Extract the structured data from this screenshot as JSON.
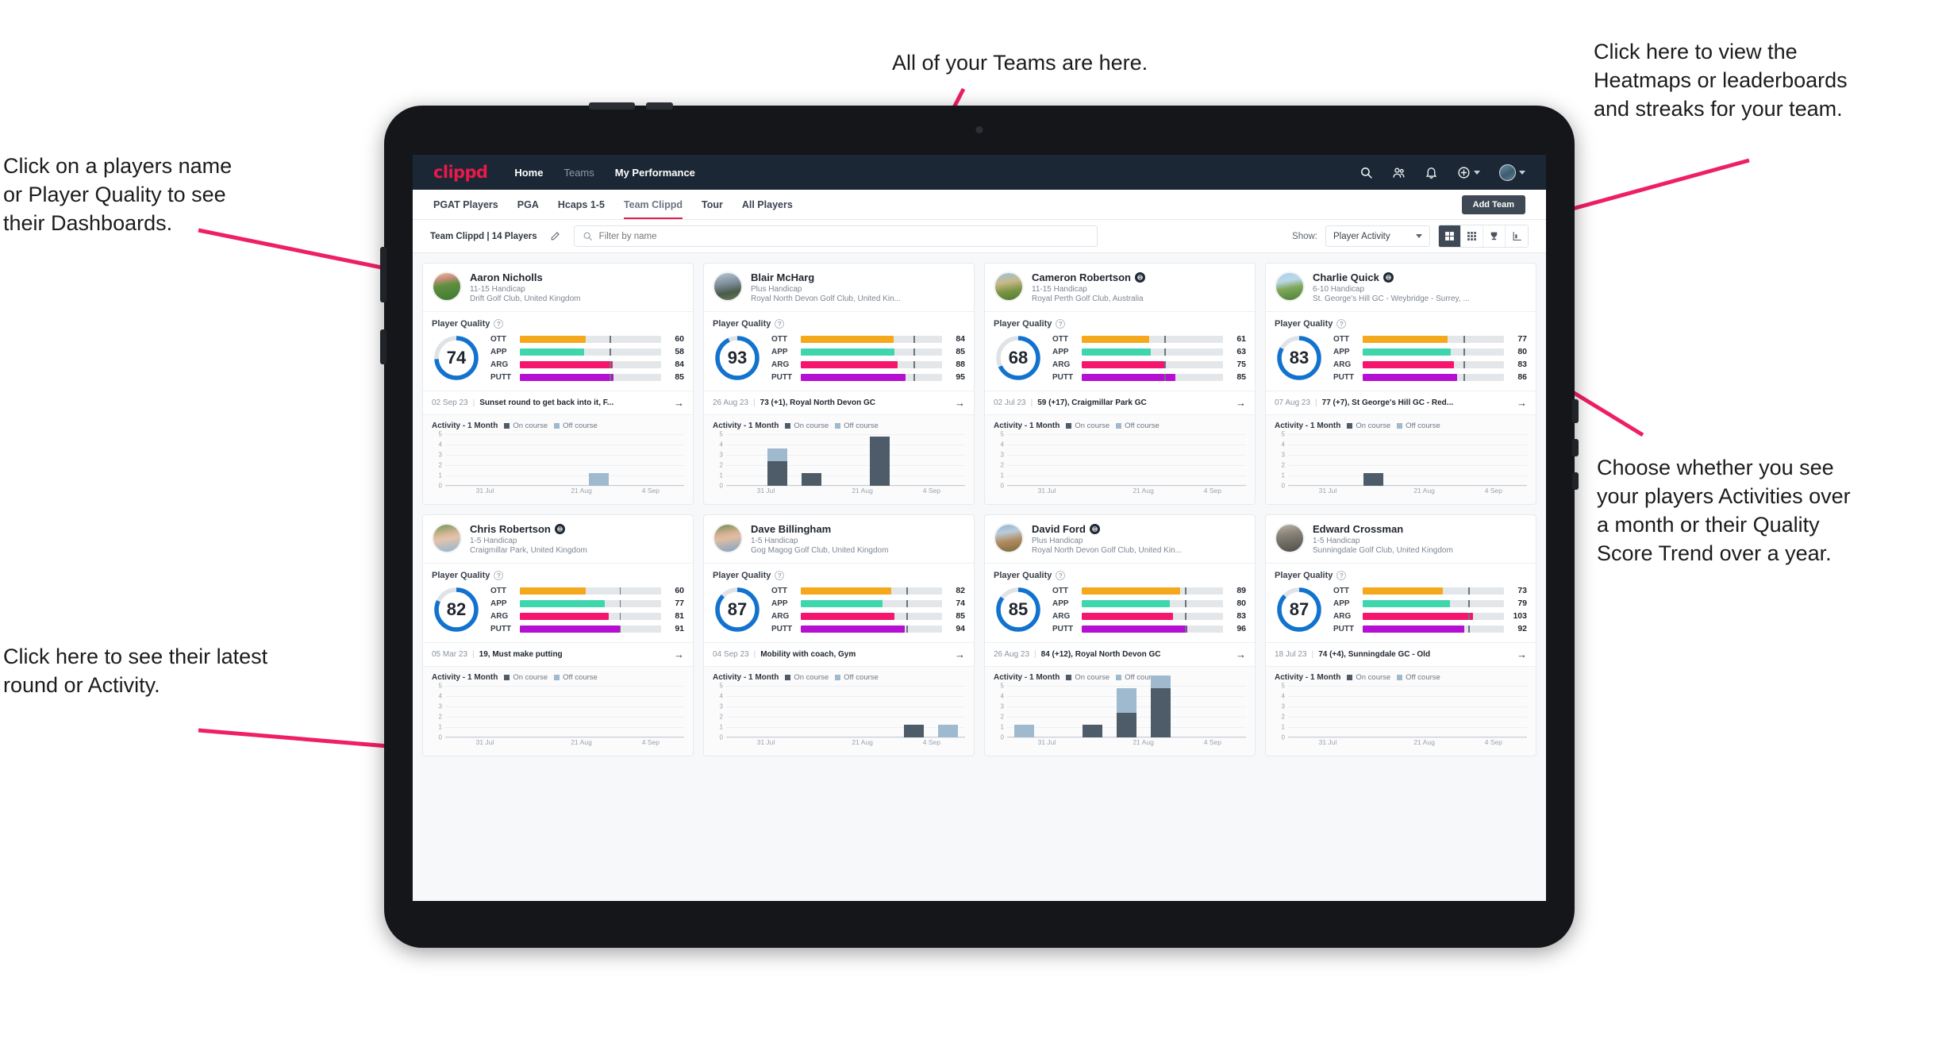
{
  "annotations": [
    {
      "id": "teams",
      "text": "All of your Teams are here."
    },
    {
      "id": "heatmaps",
      "text": "Click here to view the\nHeatmaps or leaderboards\nand streaks for your team."
    },
    {
      "id": "dashboards",
      "text": "Click on a players name\nor Player Quality to see\ntheir Dashboards."
    },
    {
      "id": "choose",
      "text": "Choose whether you see\nyour players Activities over\na month or their Quality\nScore Trend over a year."
    },
    {
      "id": "latest",
      "text": "Click here to see their latest\nround or Activity."
    }
  ],
  "navbar": {
    "logo": "clippd",
    "links": [
      {
        "label": "Home",
        "active": true
      },
      {
        "label": "Teams",
        "active": false
      },
      {
        "label": "My Performance",
        "active": true
      }
    ],
    "icons": [
      "search-icon",
      "people-icon",
      "bell-icon",
      "plus-circle-icon",
      "avatar"
    ]
  },
  "tabs": [
    {
      "label": "PGAT Players",
      "active": false
    },
    {
      "label": "PGA",
      "active": false
    },
    {
      "label": "Hcaps 1-5",
      "active": false
    },
    {
      "label": "Team Clippd",
      "active": true
    },
    {
      "label": "Tour",
      "active": false
    },
    {
      "label": "All Players",
      "active": false
    }
  ],
  "add_team_label": "Add Team",
  "filterbar": {
    "team_label": "Team Clippd | 14 Players",
    "edit_icon": "pencil-icon",
    "search_placeholder": "Filter by name",
    "search_value": "",
    "show_label": "Show:",
    "show_value": "Player Activity",
    "view_modes": [
      {
        "icon": "grid-large-icon",
        "active": true
      },
      {
        "icon": "grid-small-icon",
        "active": false
      },
      {
        "icon": "trophy-icon",
        "active": false
      },
      {
        "icon": "heatmap-icon",
        "active": false
      }
    ]
  },
  "quality_label": "Player Quality",
  "metric_labels": [
    "OTT",
    "APP",
    "ARG",
    "PUTT"
  ],
  "metric_colors": [
    "#f5a81c",
    "#3fd6ae",
    "#f5156c",
    "#b50fd1"
  ],
  "activity": {
    "title": "Activity - 1 Month",
    "legend": [
      {
        "label": "On course",
        "color": "#4e5b68"
      },
      {
        "label": "Off course",
        "color": "#9fb9cf"
      }
    ],
    "yticks": [
      5,
      4,
      3,
      2,
      1,
      0
    ],
    "xticks": [
      "31 Jul",
      "21 Aug",
      "4 Sep"
    ],
    "ymax": 5
  },
  "players": [
    {
      "name": "Aaron Nicholls",
      "verified": false,
      "handicap": "11-15 Handicap",
      "club": "Drift Golf Club, United Kingdom",
      "avatar_css": "linear-gradient(170deg,#f3b99a 0%,#c98f7e 22%,#5f8f3e 45%,#3f7a33 100%)",
      "quality": 74,
      "metrics": [
        60,
        58,
        84,
        85
      ],
      "ticks": [
        74,
        74,
        74,
        74
      ],
      "round": {
        "date": "02 Sep 23",
        "desc": "Sunset round to get back into it, F..."
      },
      "chart_data": {
        "type": "bar",
        "title": "Activity - 1 Month",
        "categories": [
          "31 Jul",
          "21 Aug",
          "4 Sep"
        ],
        "ylim": [
          0,
          5
        ],
        "series": [
          {
            "name": "On course",
            "values": [
              0,
              0,
              0,
              0,
              0,
              0,
              0
            ]
          },
          {
            "name": "Off course",
            "values": [
              0,
              0,
              0,
              0,
              1,
              0,
              0
            ]
          }
        ]
      }
    },
    {
      "name": "Blair McHarg",
      "verified": false,
      "handicap": "Plus Handicap",
      "club": "Royal North Devon Golf Club, United Kin...",
      "avatar_css": "linear-gradient(170deg,#b9c7d4 0%,#7e8e9c 40%,#4a5b4a 70%,#6a7a55 100%)",
      "quality": 93,
      "metrics": [
        84,
        85,
        88,
        95
      ],
      "ticks": [
        93,
        93,
        93,
        93
      ],
      "round": {
        "date": "26 Aug 23",
        "desc": "73 (+1), Royal North Devon GC"
      },
      "chart_data": {
        "type": "bar",
        "title": "Activity - 1 Month",
        "categories": [
          "31 Jul",
          "21 Aug",
          "4 Sep"
        ],
        "ylim": [
          0,
          5
        ],
        "series": [
          {
            "name": "On course",
            "values": [
              0,
              2,
              1,
              0,
              4,
              0,
              0
            ]
          },
          {
            "name": "Off course",
            "values": [
              0,
              1,
              0,
              0,
              0,
              0,
              0
            ]
          }
        ]
      }
    },
    {
      "name": "Cameron Robertson",
      "verified": true,
      "handicap": "11-15 Handicap",
      "club": "Royal Perth Golf Club, Australia",
      "avatar_css": "linear-gradient(170deg,#9dc3e0 0%,#c9b98a 35%,#7a9442 65%,#4f7a2e 100%)",
      "quality": 68,
      "metrics": [
        61,
        63,
        75,
        85
      ],
      "ticks": [
        68,
        68,
        68,
        68
      ],
      "round": {
        "date": "02 Jul 23",
        "desc": "59 (+17), Craigmillar Park GC"
      },
      "chart_data": {
        "type": "bar",
        "title": "Activity - 1 Month",
        "categories": [
          "31 Jul",
          "21 Aug",
          "4 Sep"
        ],
        "ylim": [
          0,
          5
        ],
        "series": [
          {
            "name": "On course",
            "values": [
              0,
              0,
              0,
              0,
              0,
              0,
              0
            ]
          },
          {
            "name": "Off course",
            "values": [
              0,
              0,
              0,
              0,
              0,
              0,
              0
            ]
          }
        ]
      }
    },
    {
      "name": "Charlie Quick",
      "verified": true,
      "handicap": "6-10 Handicap",
      "club": "St. George's Hill GC - Weybridge - Surrey, ...",
      "avatar_css": "linear-gradient(170deg,#a8d0ea 0%,#bcd8ea 30%,#7fa85a 55%,#4e8039 100%)",
      "quality": 83,
      "metrics": [
        77,
        80,
        83,
        86
      ],
      "ticks": [
        83,
        83,
        83,
        83
      ],
      "round": {
        "date": "07 Aug 23",
        "desc": "77 (+7), St George's Hill GC - Red..."
      },
      "chart_data": {
        "type": "bar",
        "title": "Activity - 1 Month",
        "categories": [
          "31 Jul",
          "21 Aug",
          "4 Sep"
        ],
        "ylim": [
          0,
          5
        ],
        "series": [
          {
            "name": "On course",
            "values": [
              0,
              0,
              1,
              0,
              0,
              0,
              0
            ]
          },
          {
            "name": "Off course",
            "values": [
              0,
              0,
              0,
              0,
              0,
              0,
              0
            ]
          }
        ]
      }
    },
    {
      "name": "Chris Robertson",
      "verified": true,
      "handicap": "1-5 Handicap",
      "club": "Craigmillar Park, United Kingdom",
      "avatar_css": "linear-gradient(170deg,#6f9a52 0%,#d9b79b 38%,#e3c4ac 52%,#8fb4d4 100%)",
      "quality": 82,
      "metrics": [
        60,
        77,
        81,
        91
      ],
      "ticks": [
        82,
        82,
        82,
        82
      ],
      "round": {
        "date": "05 Mar 23",
        "desc": "19, Must make putting"
      },
      "chart_data": {
        "type": "bar",
        "title": "Activity - 1 Month",
        "categories": [
          "31 Jul",
          "21 Aug",
          "4 Sep"
        ],
        "ylim": [
          0,
          5
        ],
        "series": [
          {
            "name": "On course",
            "values": [
              0,
              0,
              0,
              0,
              0,
              0,
              0
            ]
          },
          {
            "name": "Off course",
            "values": [
              0,
              0,
              0,
              0,
              0,
              0,
              0
            ]
          }
        ]
      }
    },
    {
      "name": "Dave Billingham",
      "verified": false,
      "handicap": "1-5 Handicap",
      "club": "Gog Magog Golf Club, United Kingdom",
      "avatar_css": "linear-gradient(170deg,#6d8f4e 0%,#d7b195 35%,#e0bda3 50%,#7fa3c4 100%)",
      "quality": 87,
      "metrics": [
        82,
        74,
        85,
        94
      ],
      "ticks": [
        87,
        87,
        87,
        87
      ],
      "round": {
        "date": "04 Sep 23",
        "desc": "Mobility with coach, Gym"
      },
      "chart_data": {
        "type": "bar",
        "title": "Activity - 1 Month",
        "categories": [
          "31 Jul",
          "21 Aug",
          "4 Sep"
        ],
        "ylim": [
          0,
          5
        ],
        "series": [
          {
            "name": "On course",
            "values": [
              0,
              0,
              0,
              0,
              0,
              1,
              0
            ]
          },
          {
            "name": "Off course",
            "values": [
              0,
              0,
              0,
              0,
              0,
              0,
              1
            ]
          }
        ]
      }
    },
    {
      "name": "David Ford",
      "verified": true,
      "handicap": "Plus Handicap",
      "club": "Royal North Devon Golf Club, United Kin...",
      "avatar_css": "linear-gradient(170deg,#8fb6d6 0%,#b9ccd9 30%,#b08a5e 60%,#7c6a3c 100%)",
      "quality": 85,
      "metrics": [
        89,
        80,
        83,
        96
      ],
      "ticks": [
        85,
        85,
        85,
        85
      ],
      "round": {
        "date": "26 Aug 23",
        "desc": "84 (+12), Royal North Devon GC"
      },
      "chart_data": {
        "type": "bar",
        "title": "Activity - 1 Month",
        "categories": [
          "31 Jul",
          "21 Aug",
          "4 Sep"
        ],
        "ylim": [
          0,
          5
        ],
        "series": [
          {
            "name": "On course",
            "values": [
              0,
              0,
              1,
              2,
              4,
              0,
              0
            ]
          },
          {
            "name": "Off course",
            "values": [
              1,
              0,
              0,
              2,
              1,
              0,
              0
            ]
          }
        ]
      }
    },
    {
      "name": "Edward Crossman",
      "verified": false,
      "handicap": "1-5 Handicap",
      "club": "Sunningdale Golf Club, United Kingdom",
      "avatar_css": "linear-gradient(170deg,#b9b2a8 0%,#8a8478 35%,#6d6a62 65%,#4f4d48 100%)",
      "quality": 87,
      "metrics": [
        73,
        79,
        103,
        92
      ],
      "ticks": [
        87,
        87,
        87,
        87
      ],
      "round": {
        "date": "18 Jul 23",
        "desc": "74 (+4), Sunningdale GC - Old"
      },
      "chart_data": {
        "type": "bar",
        "title": "Activity - 1 Month",
        "categories": [
          "31 Jul",
          "21 Aug",
          "4 Sep"
        ],
        "ylim": [
          0,
          5
        ],
        "series": [
          {
            "name": "On course",
            "values": [
              0,
              0,
              0,
              0,
              0,
              0,
              0
            ]
          },
          {
            "name": "Off course",
            "values": [
              0,
              0,
              0,
              0,
              0,
              0,
              0
            ]
          }
        ]
      }
    }
  ]
}
